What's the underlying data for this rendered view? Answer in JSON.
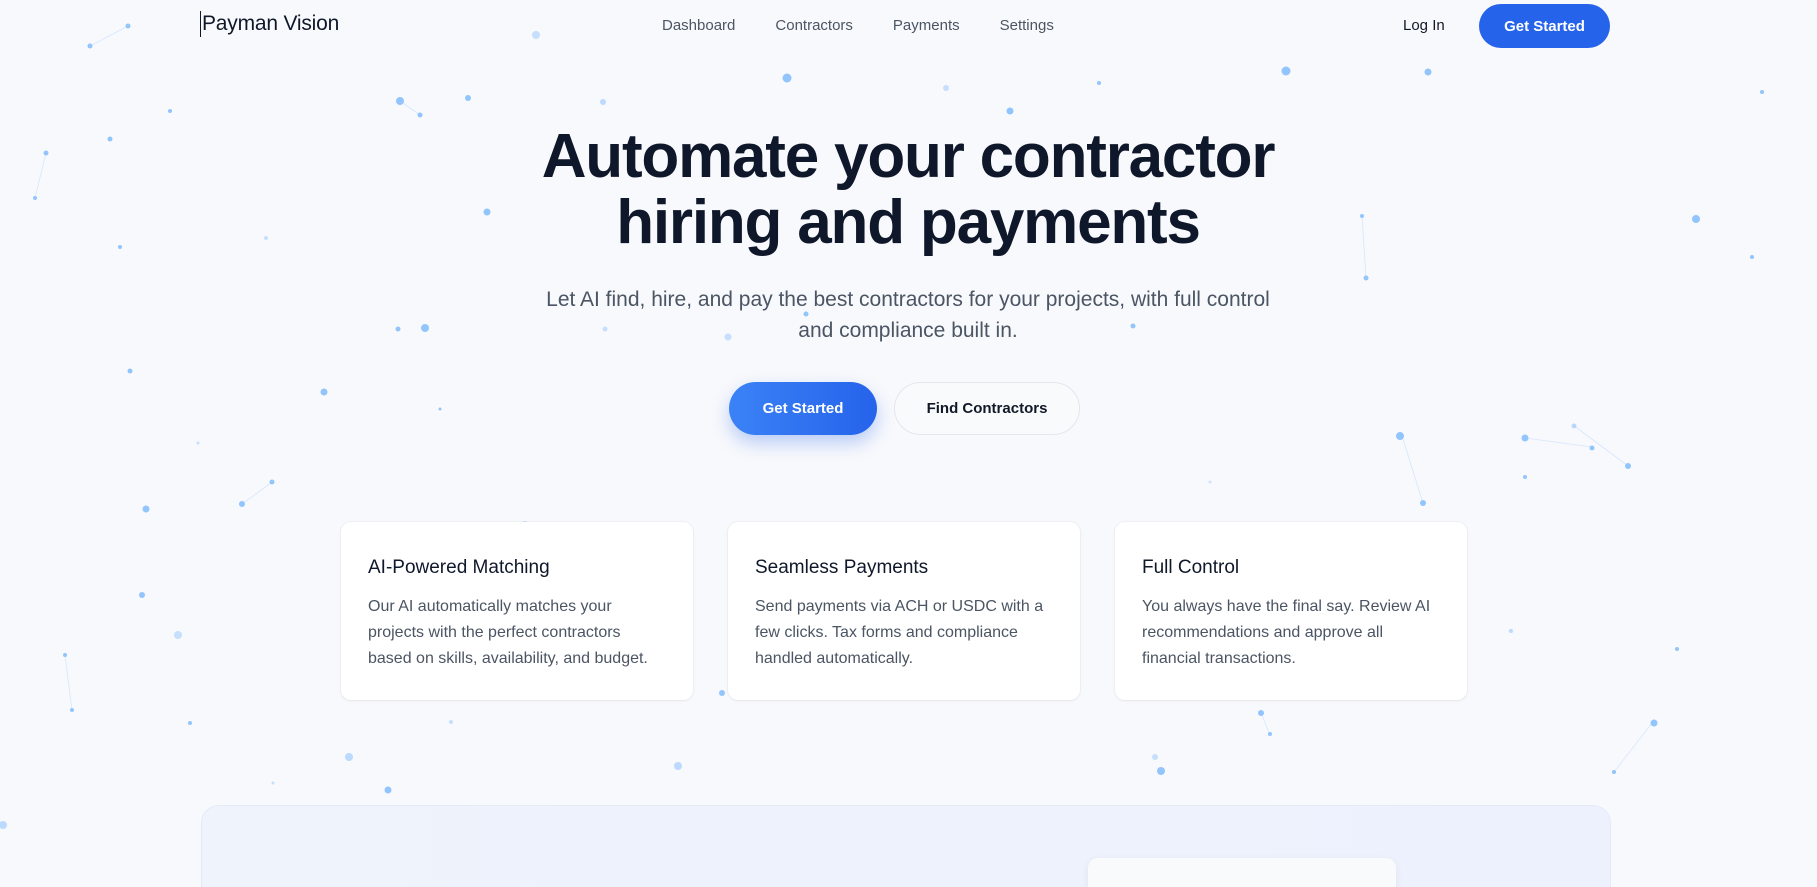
{
  "nav": {
    "brand": "Payman Vision",
    "links": [
      "Dashboard",
      "Contractors",
      "Payments",
      "Settings"
    ],
    "login_label": "Log In",
    "cta_label": "Get Started"
  },
  "hero": {
    "title_line1": "Automate your contractor",
    "title_line2": "hiring and payments",
    "subtitle_line1": "Let AI find, hire, and pay the best contractors for your projects, with full control",
    "subtitle_line2": "and compliance built in.",
    "primary_cta": "Get Started",
    "secondary_cta": "Find Contractors"
  },
  "features": [
    {
      "title": "AI-Powered Matching",
      "description": "Our AI automatically matches your projects with the perfect contractors based on skills, availability, and budget."
    },
    {
      "title": "Seamless Payments",
      "description": "Send payments via ACH or USDC with a few clicks. Tax forms and compliance handled automatically."
    },
    {
      "title": "Full Control",
      "description": "You always have the final say. Review AI recommendations and approve all financial transactions."
    }
  ],
  "colors": {
    "accent": "#2563eb",
    "background": "#f8f9fc",
    "dot": "#93c5fd"
  }
}
